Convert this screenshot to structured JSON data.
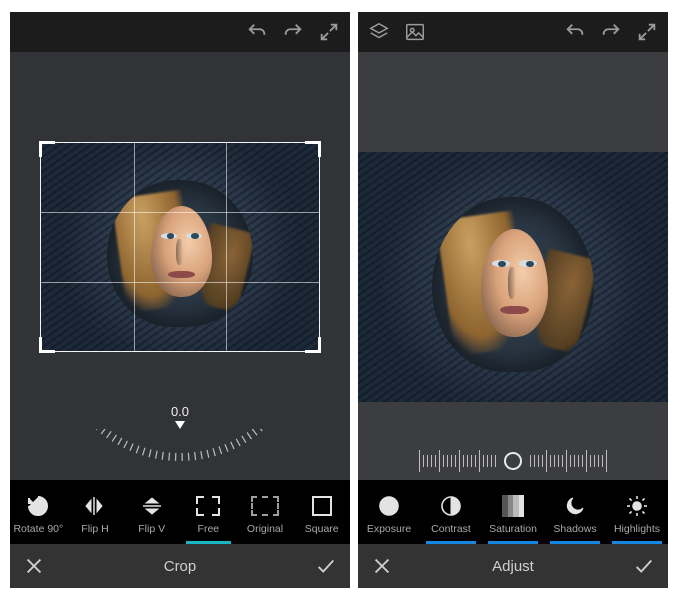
{
  "left": {
    "dial_value": "0.0",
    "tools": {
      "rotate": "Rotate 90°",
      "fliph": "Flip H",
      "flipv": "Flip V",
      "free": "Free",
      "original": "Original",
      "square": "Square"
    },
    "active_tool": "free",
    "bottom_title": "Crop"
  },
  "right": {
    "tools": {
      "exposure": "Exposure",
      "contrast": "Contrast",
      "saturation": "Saturation",
      "shadows": "Shadows",
      "highlights": "Highlights"
    },
    "slider_value": 0,
    "bottom_title": "Adjust"
  },
  "icons": {
    "layers": "layers-icon",
    "image": "image-icon",
    "undo": "undo-icon",
    "redo": "redo-icon",
    "expand": "expand-icon",
    "close": "close-icon",
    "confirm": "checkmark-icon"
  }
}
